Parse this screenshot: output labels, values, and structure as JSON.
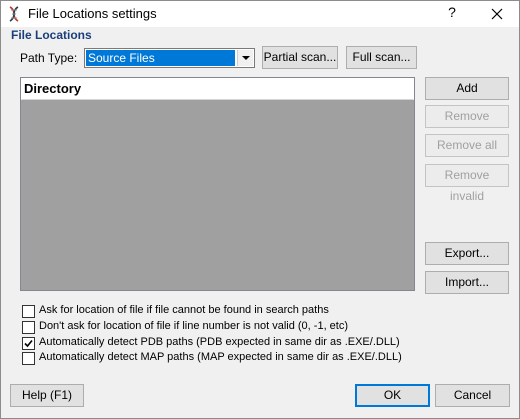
{
  "window": {
    "title": "File Locations settings",
    "help_glyph": "?",
    "close_glyph": "✕"
  },
  "section": {
    "label": "File Locations"
  },
  "path_type": {
    "label": "Path Type:",
    "selected": "Source Files"
  },
  "scan_buttons": {
    "partial": "Partial scan...",
    "full": "Full scan..."
  },
  "directory_list": {
    "column_header": "Directory",
    "rows": []
  },
  "side_buttons": {
    "add": "Add",
    "remove": "Remove",
    "remove_all": "Remove all",
    "remove_invalid": "Remove invalid",
    "export": "Export...",
    "import": "Import..."
  },
  "options": [
    {
      "label": "Ask for location of file if file cannot be found in search paths",
      "checked": false
    },
    {
      "label": "Don't ask for location of file if line number is not valid (0, -1, etc)",
      "checked": false
    },
    {
      "label": "Automatically detect PDB paths (PDB expected in same dir as .EXE/.DLL)",
      "checked": true
    },
    {
      "label": "Automatically detect MAP paths (MAP expected in same dir as .EXE/.DLL)",
      "checked": false
    }
  ],
  "footer": {
    "help": "Help (F1)",
    "ok": "OK",
    "cancel": "Cancel"
  },
  "colors": {
    "accent": "#0078d7",
    "section_label": "#1a3f7a",
    "list_background": "#a0a0a0"
  },
  "icons": {
    "app": "dna-icon",
    "check": "checkmark-icon"
  }
}
